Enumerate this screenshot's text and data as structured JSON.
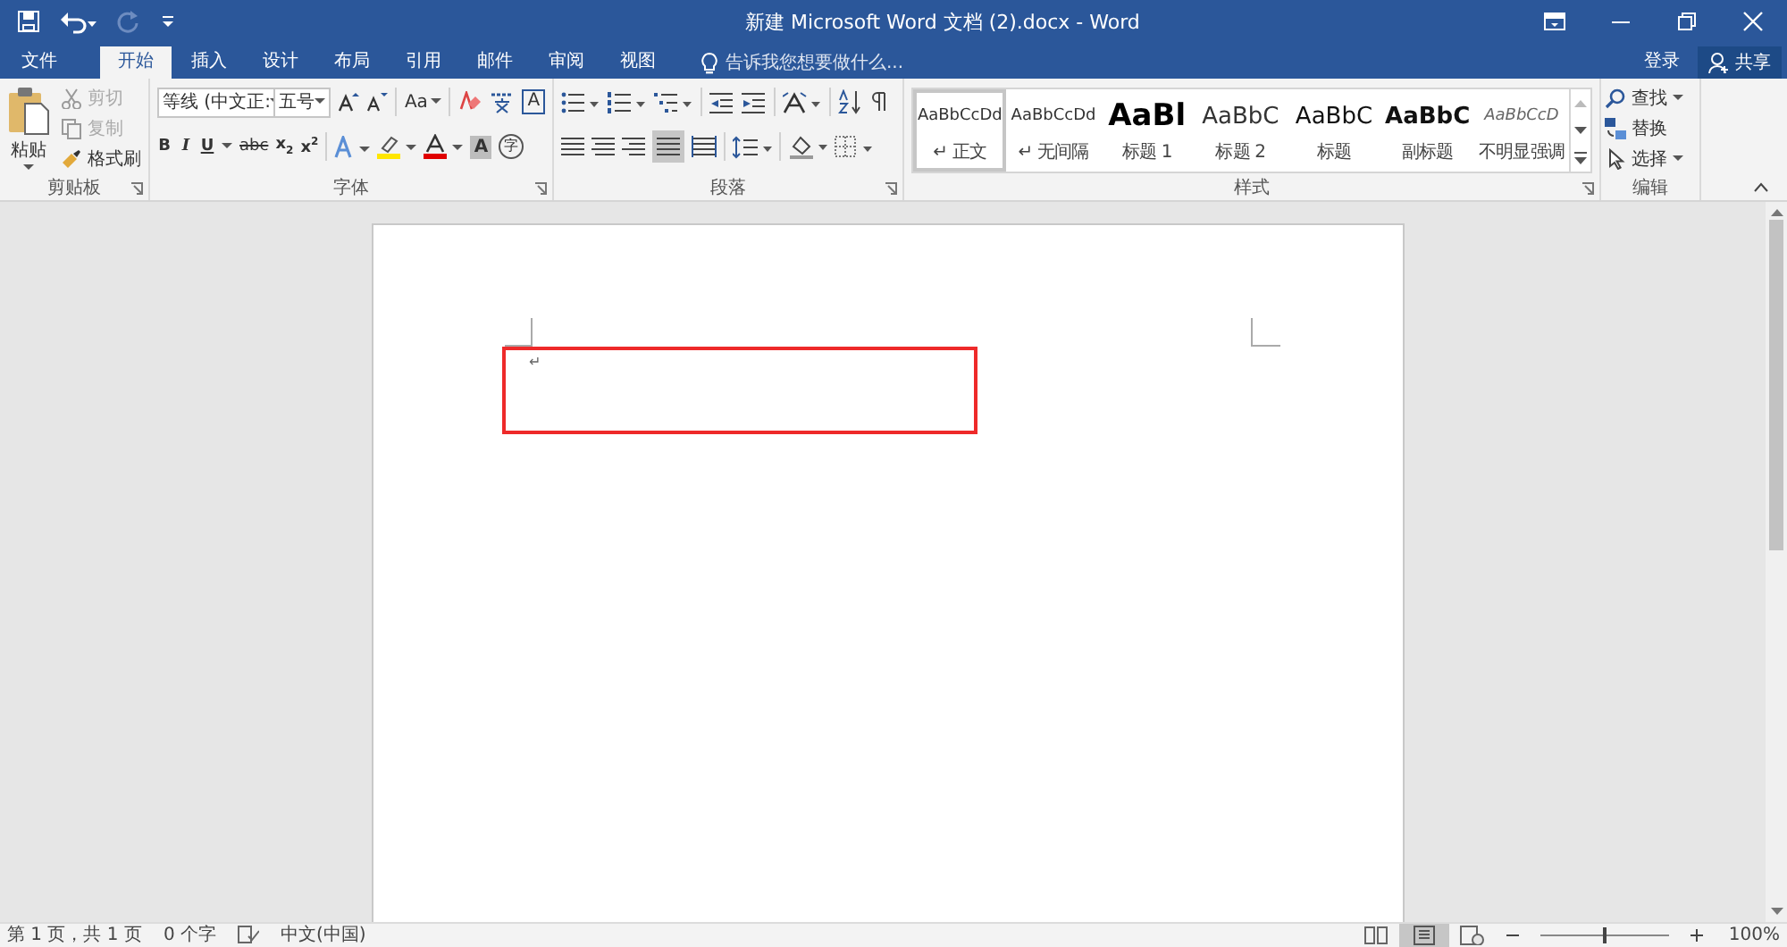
{
  "window": {
    "title": "新建 Microsoft Word 文档 (2).docx - Word",
    "sign_in": "登录",
    "share": "共享"
  },
  "tabs": [
    {
      "label": "文件",
      "kind": "file",
      "selected": false
    },
    {
      "label": "开始",
      "kind": "tab",
      "selected": true
    },
    {
      "label": "插入",
      "kind": "tab",
      "selected": false
    },
    {
      "label": "设计",
      "kind": "tab",
      "selected": false
    },
    {
      "label": "布局",
      "kind": "tab",
      "selected": false
    },
    {
      "label": "引用",
      "kind": "tab",
      "selected": false
    },
    {
      "label": "邮件",
      "kind": "tab",
      "selected": false
    },
    {
      "label": "审阅",
      "kind": "tab",
      "selected": false
    },
    {
      "label": "视图",
      "kind": "tab",
      "selected": false
    }
  ],
  "tell_me": {
    "placeholder": "告诉我您想要做什么..."
  },
  "clipboard": {
    "label": "剪贴板",
    "paste": "粘贴",
    "cut": {
      "label": "剪切",
      "disabled": true
    },
    "copy": {
      "label": "复制",
      "disabled": true
    },
    "format_painter": {
      "label": "格式刷",
      "disabled": false
    }
  },
  "font": {
    "label": "字体",
    "font_name": "等线 (中文正:",
    "font_size": "五号",
    "case_button": "Aa",
    "format_buttons": [
      "B",
      "I",
      "U",
      "abc",
      "x$_{2}$",
      "x$^{2}$"
    ],
    "border_button": "A",
    "shading_button": "A",
    "enclose_button": "字"
  },
  "paragraph": {
    "label": "段落"
  },
  "styles": {
    "label": "样式",
    "items": [
      {
        "preview": "AaBbCcDd",
        "name": "↵ 正文",
        "kind": "normal",
        "selected": true
      },
      {
        "preview": "AaBbCcDd",
        "name": "↵ 无间隔",
        "kind": "normal",
        "selected": false
      },
      {
        "preview": "AaBl",
        "name": "标题 1",
        "kind": "heading1",
        "selected": false
      },
      {
        "preview": "AaBbC",
        "name": "标题 2",
        "kind": "heading2",
        "selected": false
      },
      {
        "preview": "AaBbC",
        "name": "标题",
        "kind": "title",
        "selected": false
      },
      {
        "preview": "AaBbC",
        "name": "副标题",
        "kind": "subtitle",
        "selected": false
      },
      {
        "preview": "AaBbCcD",
        "name": "不明显强调",
        "kind": "emphasis",
        "selected": false
      }
    ]
  },
  "editing": {
    "label": "编辑",
    "find": "查找",
    "replace": "替换",
    "select": "选择"
  },
  "document": {
    "paragraph_mark": "↵",
    "highlight": true
  },
  "status_bar": {
    "page": "第 1 页，共 1 页",
    "words": "0 个字",
    "language": "中文(中国)",
    "zoom": "100%",
    "zoom_level": {
      "level": 0.5
    }
  }
}
